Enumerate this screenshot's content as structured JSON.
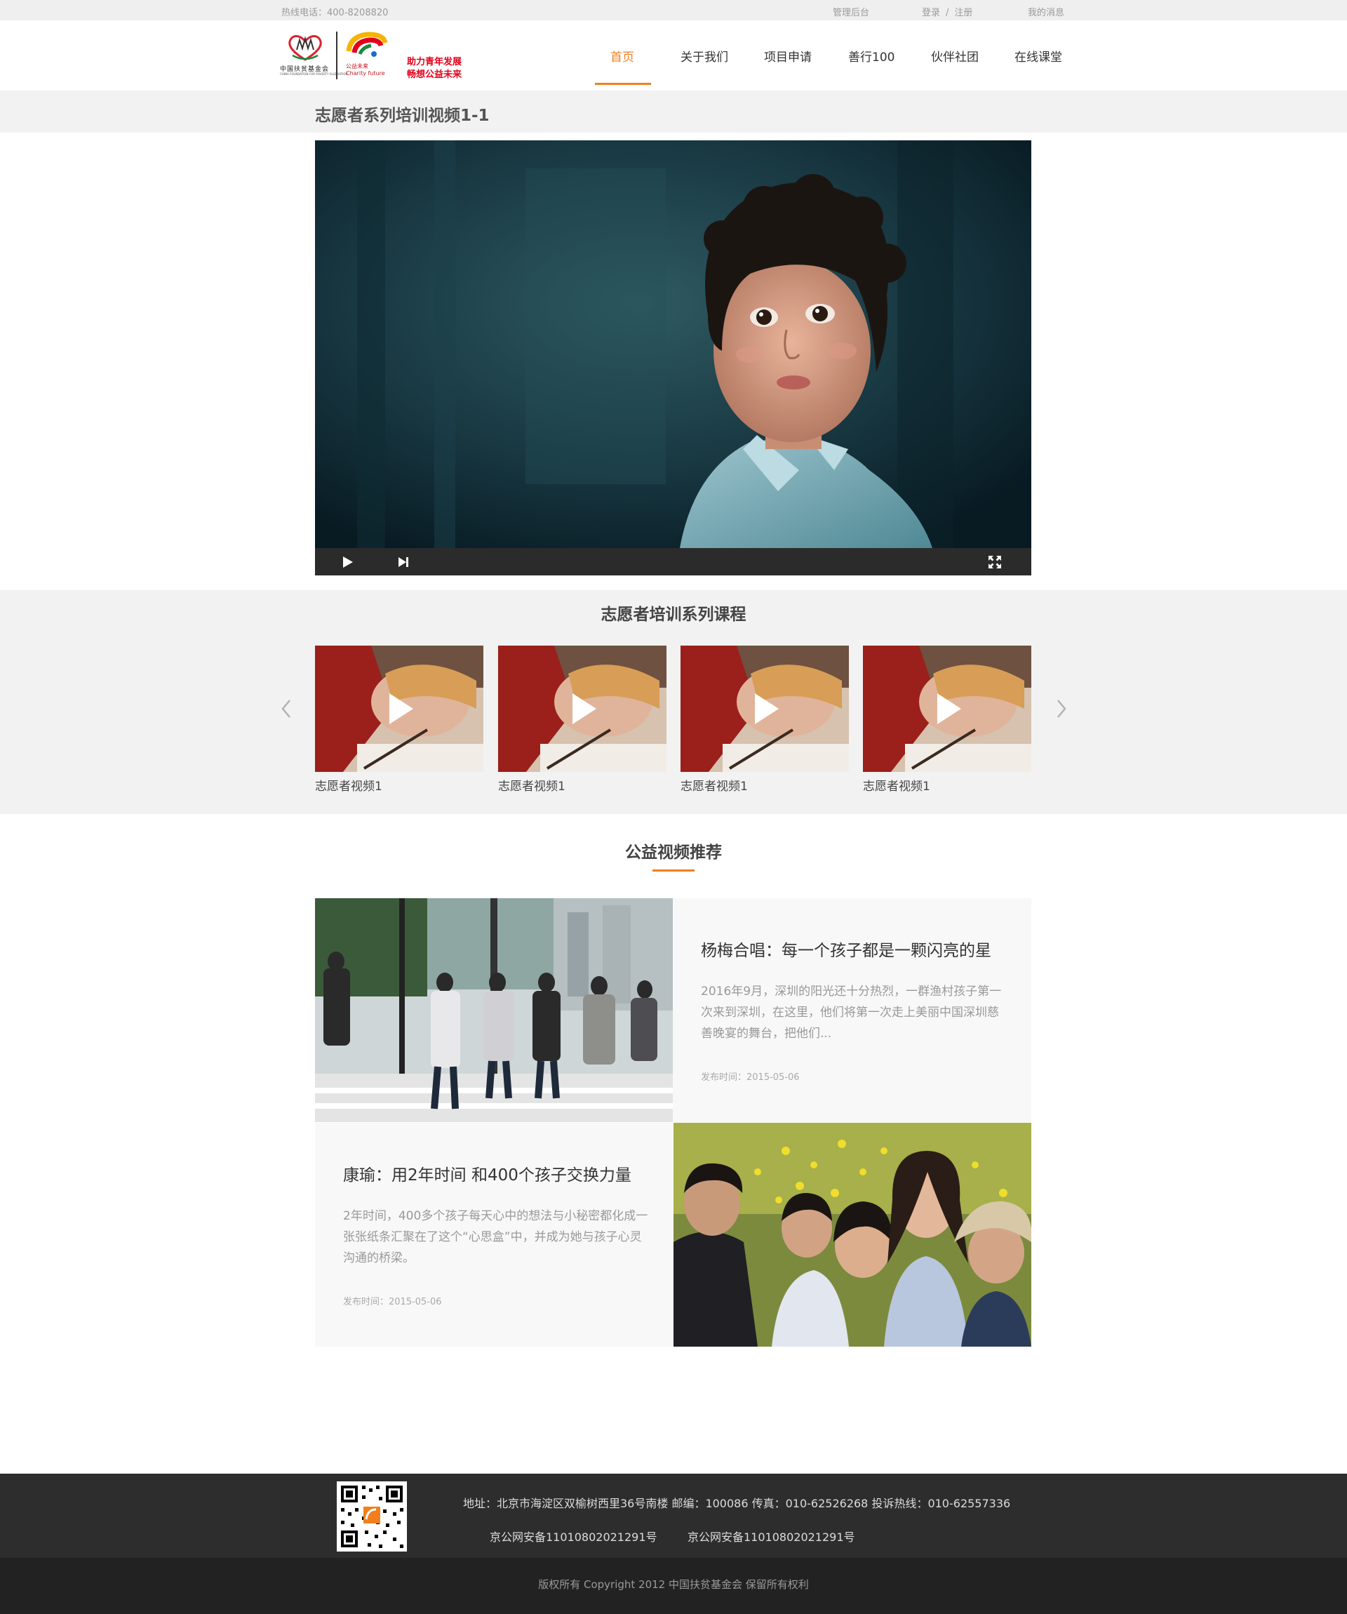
{
  "topbar": {
    "hotline": "热线电话：400-8208820",
    "admin": "管理后台",
    "login": "登录",
    "separator": "/",
    "register": "注册",
    "messages": "我的消息"
  },
  "logo": {
    "fund_name": "中国扶贫基金会",
    "fund_en": "CHINA FOUNDATION FOR POVERTY ALLEVIATION",
    "charity_cn": "公益未来",
    "charity_en": "Charity future",
    "slogan_line1": "助力青年发展",
    "slogan_line2": "畅想公益未来"
  },
  "nav": {
    "items": [
      {
        "label": "首页",
        "active": true
      },
      {
        "label": "关于我们",
        "active": false
      },
      {
        "label": "项目申请",
        "active": false
      },
      {
        "label": "善行100",
        "active": false
      },
      {
        "label": "伙伴社团",
        "active": false
      },
      {
        "label": "在线课堂",
        "active": false
      }
    ]
  },
  "page": {
    "title": "志愿者系列培训视频1-1"
  },
  "player": {
    "controls": [
      "play-icon",
      "next-icon",
      "fullscreen-icon"
    ]
  },
  "courses": {
    "title": "志愿者培训系列课程",
    "items": [
      {
        "caption": "志愿者视频1"
      },
      {
        "caption": "志愿者视频1"
      },
      {
        "caption": "志愿者视频1"
      },
      {
        "caption": "志愿者视频1"
      }
    ]
  },
  "recommend": {
    "title": "公益视频推荐",
    "items": [
      {
        "title": "杨梅合唱：每一个孩子都是一颗闪亮的星",
        "desc": "2016年9月，深圳的阳光还十分热烈，一群渔村孩子第一次来到深圳，在这里，他们将第一次走上美丽中国深圳慈善晚宴的舞台，把他们...",
        "date": "发布时间：2015-05-06"
      },
      {
        "title": "康瑜：用2年时间 和400个孩子交换力量",
        "desc": "2年时间，400多个孩子每天心中的想法与小秘密都化成一张张纸条汇聚在了这个“心思盒”中，并成为她与孩子心灵沟通的桥梁。",
        "date": "发布时间：2015-05-06"
      }
    ]
  },
  "footer": {
    "address": "地址：北京市海淀区双榆树西里36号南楼 邮编：100086 传真：010-62526268 投诉热线：010-62557336",
    "icp1": "京公网安备11010802021291号",
    "icp2": "京公网安备11010802021291号",
    "copyright": "版权所有 Copyright 2012 中国扶贫基金会 保留所有权利"
  },
  "colors": {
    "accent": "#f07f1e",
    "footer_bg": "#2d2d2d",
    "copyright_bg": "#222222",
    "strip_bg": "#f2f2f2"
  }
}
